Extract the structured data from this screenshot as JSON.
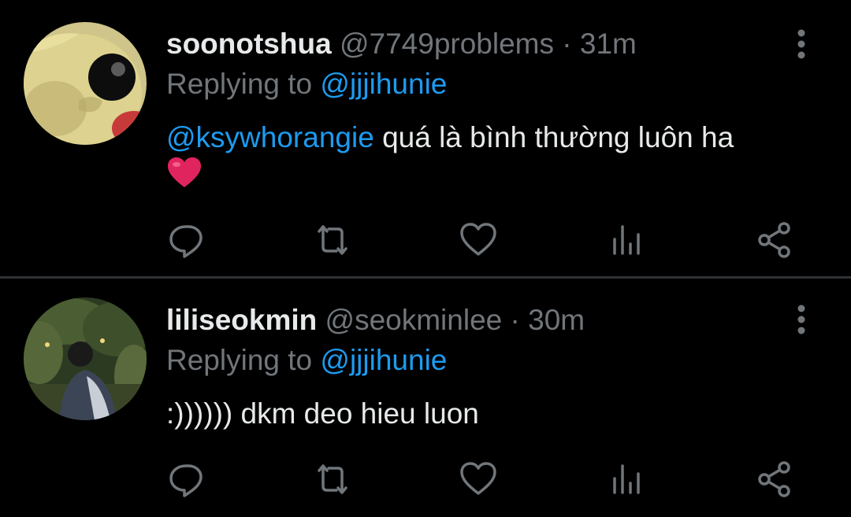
{
  "colors": {
    "background": "#000000",
    "text": "#e7e9ea",
    "secondary": "#71767b",
    "mention": "#1d9bf0",
    "divider": "#2f3336",
    "heart": "#e0245e"
  },
  "tweets": [
    {
      "display_name": "soonotshua",
      "handle": "@7749problems",
      "separator": "·",
      "time": "31m",
      "replying_prefix": "Replying to",
      "replying_to": "@jjjihunie",
      "mention": "@ksywhorangie",
      "text": "quá là bình thường luôn ha",
      "emoji": "red-heart",
      "avatar": "yellow-plush-avatar"
    },
    {
      "display_name": "liliseokmin",
      "handle": "@seokminlee",
      "separator": "·",
      "time": "30m",
      "replying_prefix": "Replying to",
      "replying_to": "@jjjihunie",
      "text": ":)))))) dkm deo hieu luon",
      "avatar": "photo-avatar"
    }
  ],
  "actions": [
    "reply-icon",
    "retweet-icon",
    "like-icon",
    "analytics-icon",
    "share-icon"
  ]
}
